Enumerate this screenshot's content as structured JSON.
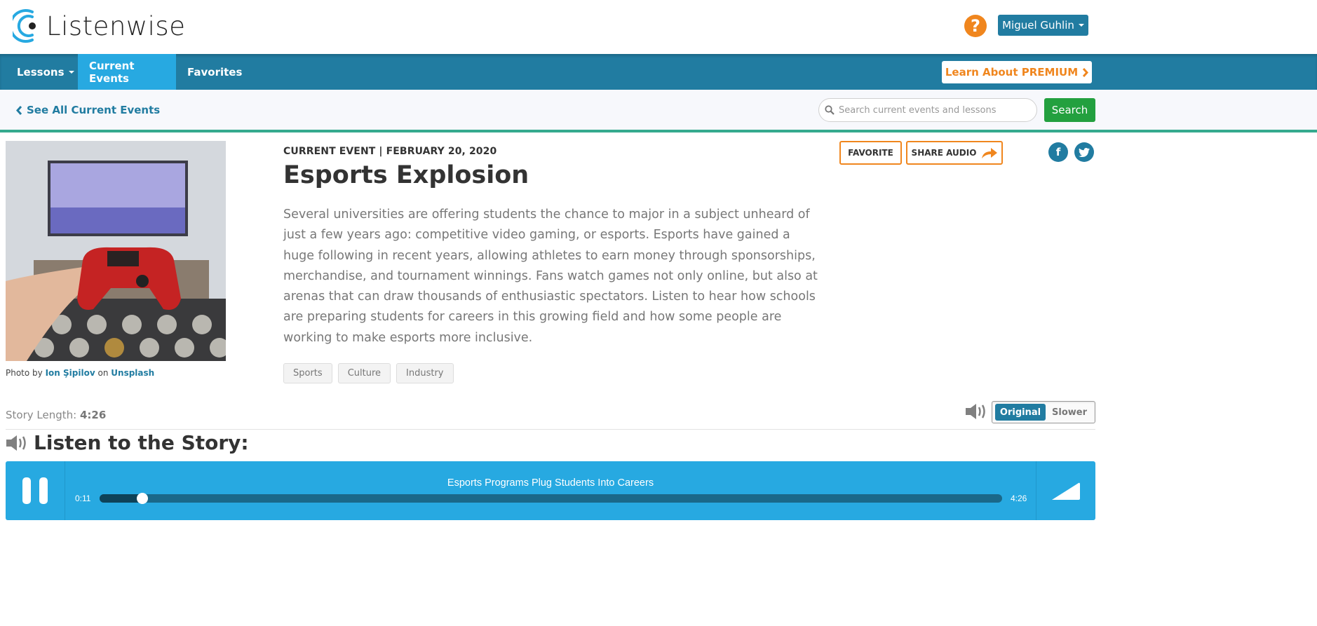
{
  "header": {
    "logo_text": "Listenwise",
    "help_icon": "question-circle-icon",
    "user_menu_label": "Miguel Guhlin"
  },
  "nav": {
    "items": [
      {
        "label": "Lessons",
        "has_dropdown": true,
        "active": false
      },
      {
        "label": "Current Events",
        "has_dropdown": false,
        "active": true
      },
      {
        "label": "Favorites",
        "has_dropdown": false,
        "active": false
      }
    ],
    "premium_label": "Learn About PREMIUM"
  },
  "subbar": {
    "back_link": "See All Current Events",
    "search_placeholder": "Search current events and lessons",
    "search_value": "",
    "search_button": "Search"
  },
  "photo": {
    "alt": "Hand holding red game controller in front of TV",
    "caption_prefix": "Photo by",
    "author": "Ion Şipilov",
    "caption_mid": "on",
    "source": "Unsplash"
  },
  "article": {
    "eyebrow": "CURRENT EVENT | FEBRUARY 20, 2020",
    "title": "Esports Explosion",
    "description": "Several universities are offering students the chance to major in a subject unheard of just a few years ago: competitive video gaming, or esports. Esports have gained a huge following in recent years, allowing athletes to earn money through sponsorships, merchandise, and tournament winnings. Fans watch games not only online, but also at arenas that can draw thousands of enthusiastic spectators. Listen to hear how schools are preparing students for careers in this growing field and how some people are working to make esports more inclusive.",
    "tags": [
      "Sports",
      "Culture",
      "Industry"
    ],
    "favorite_label": "FAVORITE",
    "share_label": "SHARE AUDIO",
    "social": [
      {
        "name": "facebook",
        "glyph": "f"
      },
      {
        "name": "twitter",
        "glyph": "t"
      }
    ]
  },
  "story": {
    "length_label": "Story Length:",
    "length_value": "4:26",
    "speed_options": [
      "Original",
      "Slower"
    ],
    "speed_selected": "Original",
    "listen_heading": "Listen to the Story:"
  },
  "player": {
    "track_title": "Esports Programs Plug Students Into Careers",
    "current_time": "0:11",
    "total_time": "4:26",
    "progress_fraction": 0.041,
    "state": "playing"
  },
  "colors": {
    "brand_blue": "#217ca1",
    "active_blue": "#27a9e1",
    "orange": "#f0861e",
    "green": "#23a03f",
    "teal_rule": "#35aa8e"
  }
}
